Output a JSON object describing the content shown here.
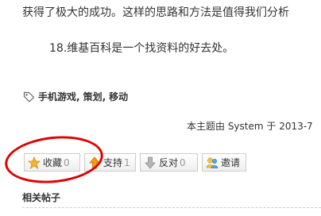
{
  "article": {
    "line1": "获得了极大的成功。这样的思路和方法是值得我们分析",
    "line2": "18.维基百科是一个找资料的好去处。"
  },
  "tags": {
    "icon": "tag-icon",
    "items": [
      {
        "label": "手机游戏",
        "sep": ","
      },
      {
        "label": "策划",
        "sep": ","
      },
      {
        "label": "移动",
        "sep": ""
      }
    ]
  },
  "meta": {
    "text": "本主题由 System 于 2013-7"
  },
  "actions": {
    "favorite": {
      "label": "收藏",
      "count": "0",
      "icon": "star-icon"
    },
    "support": {
      "label": "支持",
      "count": "1",
      "icon": "thumb-up-icon"
    },
    "oppose": {
      "label": "反对",
      "count": "0",
      "icon": "thumb-down-icon"
    },
    "invite": {
      "label": "邀请",
      "icon": "invite-people-icon"
    }
  },
  "annotation": {
    "color": "#e00000"
  },
  "related": {
    "title": "相关帖子"
  }
}
